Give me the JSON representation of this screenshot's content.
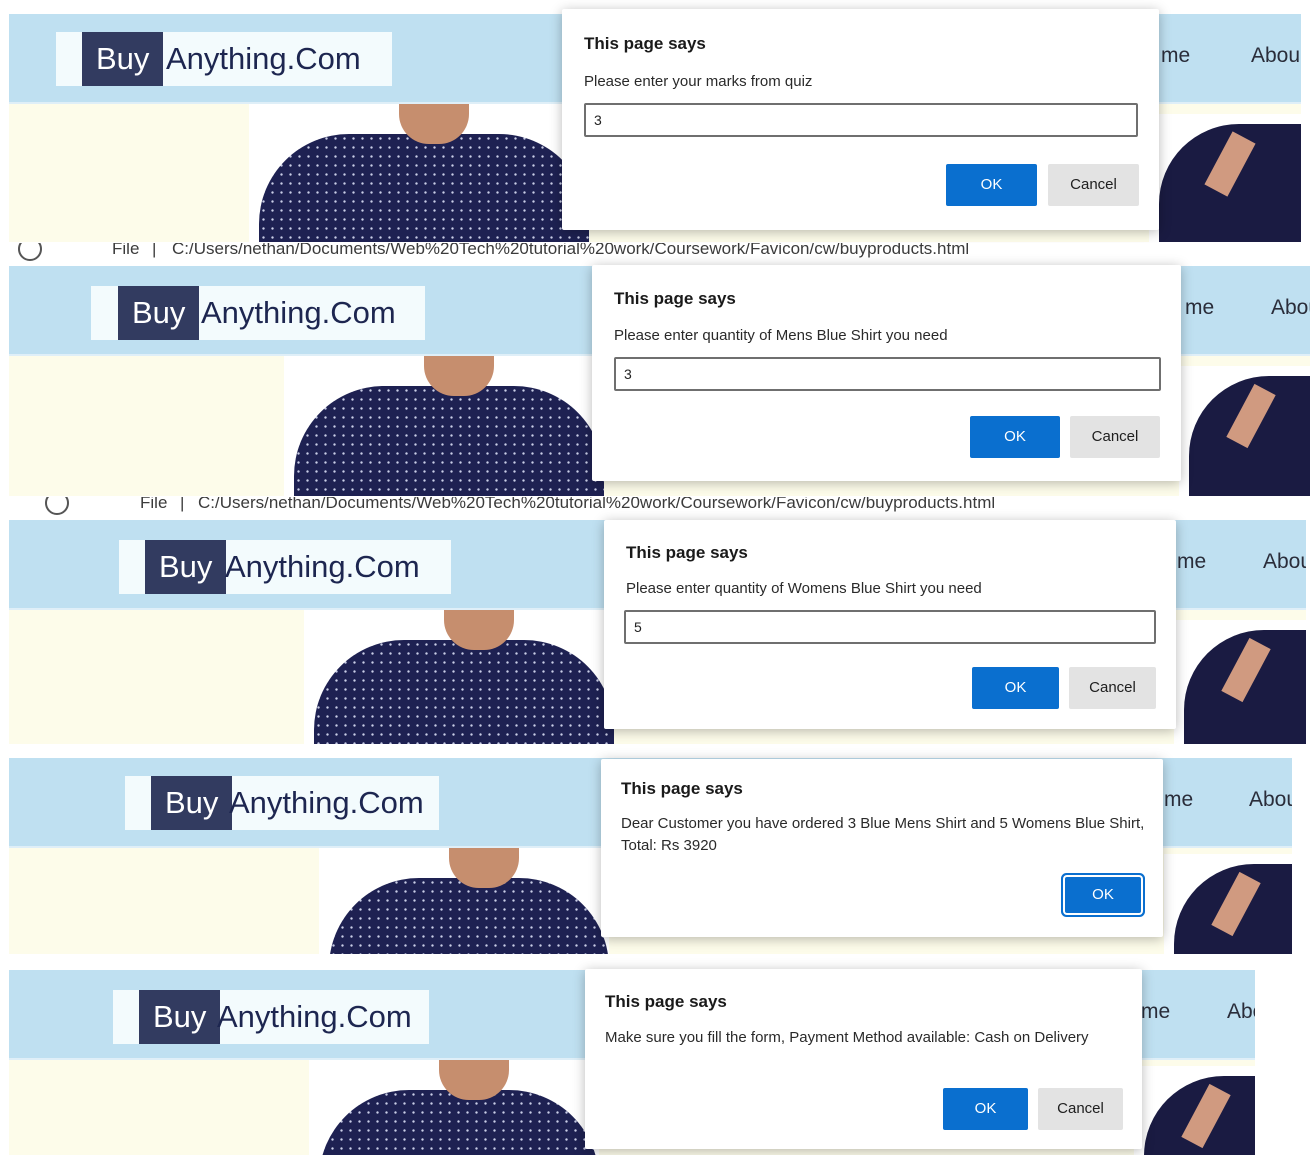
{
  "site": {
    "logo_buy": "Buy",
    "logo_rest": "Anything.Com",
    "nav_home_partial": "me",
    "nav_about_partial": "Abou"
  },
  "browser": {
    "info_icon": "info-icon",
    "file_label": "File",
    "separator": "|",
    "address": "C:/Users/nethan/Documents/Web%20Tech%20tutorial%20work/Coursework/Favicon/cw/buyproducts.html"
  },
  "dialogs": [
    {
      "title": "This page says",
      "message": "Please enter your marks from quiz",
      "input_value": "3",
      "ok_label": "OK",
      "cancel_label": "Cancel"
    },
    {
      "title": "This page says",
      "message": "Please enter quantity of Mens Blue Shirt you need",
      "input_value": "3",
      "ok_label": "OK",
      "cancel_label": "Cancel"
    },
    {
      "title": "This page says",
      "message": "Please enter quantity of Womens Blue Shirt you need",
      "input_value": "5",
      "ok_label": "OK",
      "cancel_label": "Cancel"
    },
    {
      "title": "This page says",
      "message": "Dear Customer you have ordered 3 Blue Mens Shirt and 5 Womens Blue Shirt, Total: Rs 3920",
      "ok_label": "OK"
    },
    {
      "title": "This page says",
      "message": "Make sure you fill the form, Payment Method available: Cash on Delivery",
      "ok_label": "OK",
      "cancel_label": "Cancel"
    }
  ],
  "colors": {
    "header_bg": "#bfe0f1",
    "logo_dark": "#323b60",
    "primary_button": "#0a6fcf",
    "page_bg": "#fdfcea"
  }
}
